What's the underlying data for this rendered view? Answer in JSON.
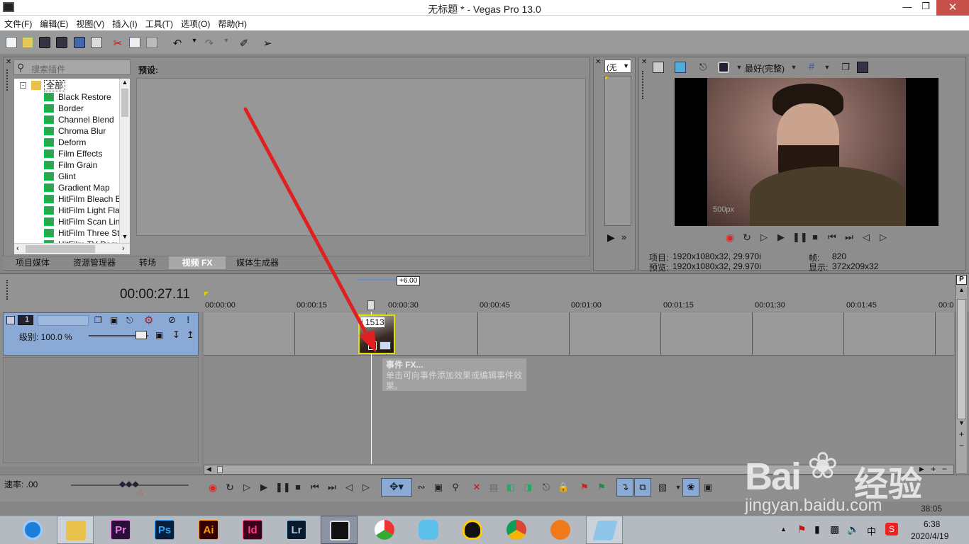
{
  "window": {
    "title": "无标题 * - Vegas Pro 13.0"
  },
  "menu": [
    "文件(F)",
    "编辑(E)",
    "视图(V)",
    "插入(I)",
    "工具(T)",
    "选项(O)",
    "帮助(H)"
  ],
  "plugins": {
    "search_placeholder": "搜索插件",
    "root": "全部",
    "items": [
      "Black Restore",
      "Border",
      "Channel Blend",
      "Chroma Blur",
      "Deform",
      "Film Effects",
      "Film Grain",
      "Glint",
      "Gradient Map",
      "HitFilm Bleach E",
      "HitFilm Light Fla",
      "HitFilm Scan Lin",
      "HitFilm Three St",
      "HitFilm TV Dam"
    ],
    "presets_label": "预设:"
  },
  "dock_tabs": [
    "项目媒体",
    "资源管理器",
    "转场",
    "视频 FX",
    "媒体生成器"
  ],
  "trimmer": {
    "dropdown": "(无"
  },
  "preview": {
    "quality": "最好(完整)",
    "watermark": "500px",
    "project_label": "项目:",
    "project_value": "1920x1080x32, 29.970i",
    "preview_label": "预览:",
    "preview_value": "1920x1080x32, 29.970i",
    "frame_label": "帧:",
    "frame_value": "820",
    "display_label": "显示:",
    "display_value": "372x209x32"
  },
  "timeline": {
    "time": "00:00:27.11",
    "zoom_tag": "+6.00",
    "ticks": [
      "00:00:00",
      "00:00:15",
      "00:00:30",
      "00:00:45",
      "00:01:00",
      "00:01:15",
      "00:01:30",
      "00:01:45",
      "00:0"
    ],
    "track_number": "1",
    "level": "级别: 100.0 %",
    "clip_label": "j 1513",
    "tooltip_title": "事件 FX...",
    "tooltip_text": "单击可向事件添加效果或编辑事件效果。",
    "rate": "速率: .00",
    "status_right": "38:05"
  },
  "taskbar": {
    "apps": [
      "Pr",
      "Ps",
      "Ai",
      "Id",
      "Lr"
    ],
    "clock_time": "6:38",
    "clock_date": "2020/4/19",
    "ime": "中"
  },
  "watermark": {
    "brand": "Bai",
    "brand_cn": "经验",
    "url": "jingyan.baidu.com"
  },
  "colors": {
    "accent_blue": "#8aa9d4",
    "clip_border": "#e0e000",
    "arrow_red": "#e02020"
  }
}
